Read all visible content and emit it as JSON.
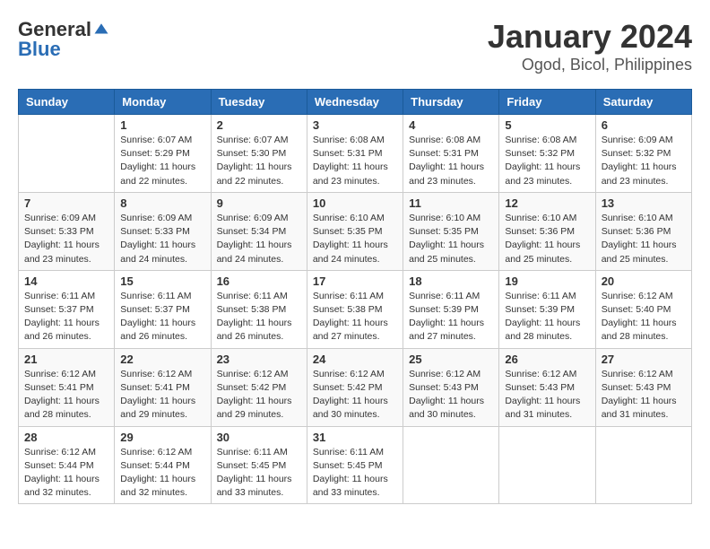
{
  "logo": {
    "part1": "General",
    "part2": "Blue"
  },
  "title": "January 2024",
  "subtitle": "Ogod, Bicol, Philippines",
  "headers": [
    "Sunday",
    "Monday",
    "Tuesday",
    "Wednesday",
    "Thursday",
    "Friday",
    "Saturday"
  ],
  "weeks": [
    [
      {
        "day": "",
        "info": ""
      },
      {
        "day": "1",
        "info": "Sunrise: 6:07 AM\nSunset: 5:29 PM\nDaylight: 11 hours\nand 22 minutes."
      },
      {
        "day": "2",
        "info": "Sunrise: 6:07 AM\nSunset: 5:30 PM\nDaylight: 11 hours\nand 22 minutes."
      },
      {
        "day": "3",
        "info": "Sunrise: 6:08 AM\nSunset: 5:31 PM\nDaylight: 11 hours\nand 23 minutes."
      },
      {
        "day": "4",
        "info": "Sunrise: 6:08 AM\nSunset: 5:31 PM\nDaylight: 11 hours\nand 23 minutes."
      },
      {
        "day": "5",
        "info": "Sunrise: 6:08 AM\nSunset: 5:32 PM\nDaylight: 11 hours\nand 23 minutes."
      },
      {
        "day": "6",
        "info": "Sunrise: 6:09 AM\nSunset: 5:32 PM\nDaylight: 11 hours\nand 23 minutes."
      }
    ],
    [
      {
        "day": "7",
        "info": "Sunrise: 6:09 AM\nSunset: 5:33 PM\nDaylight: 11 hours\nand 23 minutes."
      },
      {
        "day": "8",
        "info": "Sunrise: 6:09 AM\nSunset: 5:33 PM\nDaylight: 11 hours\nand 24 minutes."
      },
      {
        "day": "9",
        "info": "Sunrise: 6:09 AM\nSunset: 5:34 PM\nDaylight: 11 hours\nand 24 minutes."
      },
      {
        "day": "10",
        "info": "Sunrise: 6:10 AM\nSunset: 5:35 PM\nDaylight: 11 hours\nand 24 minutes."
      },
      {
        "day": "11",
        "info": "Sunrise: 6:10 AM\nSunset: 5:35 PM\nDaylight: 11 hours\nand 25 minutes."
      },
      {
        "day": "12",
        "info": "Sunrise: 6:10 AM\nSunset: 5:36 PM\nDaylight: 11 hours\nand 25 minutes."
      },
      {
        "day": "13",
        "info": "Sunrise: 6:10 AM\nSunset: 5:36 PM\nDaylight: 11 hours\nand 25 minutes."
      }
    ],
    [
      {
        "day": "14",
        "info": "Sunrise: 6:11 AM\nSunset: 5:37 PM\nDaylight: 11 hours\nand 26 minutes."
      },
      {
        "day": "15",
        "info": "Sunrise: 6:11 AM\nSunset: 5:37 PM\nDaylight: 11 hours\nand 26 minutes."
      },
      {
        "day": "16",
        "info": "Sunrise: 6:11 AM\nSunset: 5:38 PM\nDaylight: 11 hours\nand 26 minutes."
      },
      {
        "day": "17",
        "info": "Sunrise: 6:11 AM\nSunset: 5:38 PM\nDaylight: 11 hours\nand 27 minutes."
      },
      {
        "day": "18",
        "info": "Sunrise: 6:11 AM\nSunset: 5:39 PM\nDaylight: 11 hours\nand 27 minutes."
      },
      {
        "day": "19",
        "info": "Sunrise: 6:11 AM\nSunset: 5:39 PM\nDaylight: 11 hours\nand 28 minutes."
      },
      {
        "day": "20",
        "info": "Sunrise: 6:12 AM\nSunset: 5:40 PM\nDaylight: 11 hours\nand 28 minutes."
      }
    ],
    [
      {
        "day": "21",
        "info": "Sunrise: 6:12 AM\nSunset: 5:41 PM\nDaylight: 11 hours\nand 28 minutes."
      },
      {
        "day": "22",
        "info": "Sunrise: 6:12 AM\nSunset: 5:41 PM\nDaylight: 11 hours\nand 29 minutes."
      },
      {
        "day": "23",
        "info": "Sunrise: 6:12 AM\nSunset: 5:42 PM\nDaylight: 11 hours\nand 29 minutes."
      },
      {
        "day": "24",
        "info": "Sunrise: 6:12 AM\nSunset: 5:42 PM\nDaylight: 11 hours\nand 30 minutes."
      },
      {
        "day": "25",
        "info": "Sunrise: 6:12 AM\nSunset: 5:43 PM\nDaylight: 11 hours\nand 30 minutes."
      },
      {
        "day": "26",
        "info": "Sunrise: 6:12 AM\nSunset: 5:43 PM\nDaylight: 11 hours\nand 31 minutes."
      },
      {
        "day": "27",
        "info": "Sunrise: 6:12 AM\nSunset: 5:43 PM\nDaylight: 11 hours\nand 31 minutes."
      }
    ],
    [
      {
        "day": "28",
        "info": "Sunrise: 6:12 AM\nSunset: 5:44 PM\nDaylight: 11 hours\nand 32 minutes."
      },
      {
        "day": "29",
        "info": "Sunrise: 6:12 AM\nSunset: 5:44 PM\nDaylight: 11 hours\nand 32 minutes."
      },
      {
        "day": "30",
        "info": "Sunrise: 6:11 AM\nSunset: 5:45 PM\nDaylight: 11 hours\nand 33 minutes."
      },
      {
        "day": "31",
        "info": "Sunrise: 6:11 AM\nSunset: 5:45 PM\nDaylight: 11 hours\nand 33 minutes."
      },
      {
        "day": "",
        "info": ""
      },
      {
        "day": "",
        "info": ""
      },
      {
        "day": "",
        "info": ""
      }
    ]
  ]
}
